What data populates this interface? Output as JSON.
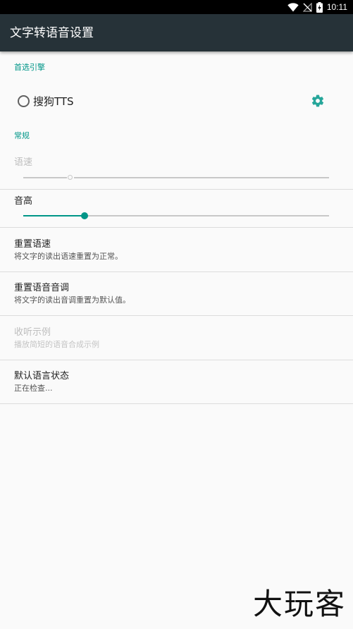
{
  "status_bar": {
    "time": "10:11",
    "icons": [
      "wifi-icon",
      "no-signal-icon",
      "battery-charging-icon"
    ]
  },
  "app_bar": {
    "title": "文字转语音设置"
  },
  "preferred_engine": {
    "category": "首选引擎",
    "engine_name": "搜狗TTS",
    "selected": false
  },
  "general": {
    "category": "常规",
    "speech_rate": {
      "title": "语速",
      "enabled": false,
      "value_fraction": 0.15
    },
    "pitch": {
      "title": "音高",
      "enabled": true,
      "value_fraction": 0.2
    },
    "reset_rate": {
      "title": "重置语速",
      "summary": "将文字的读出语速重置为正常。"
    },
    "reset_pitch": {
      "title": "重置语音音调",
      "summary": "将文字的读出音调重置为默认值。"
    },
    "listen_example": {
      "title": "收听示例",
      "summary": "播放简短的语音合成示例",
      "enabled": false
    },
    "default_language_status": {
      "title": "默认语言状态",
      "summary": "正在检查..."
    }
  },
  "watermark": "大玩客",
  "colors": {
    "accent": "#009688",
    "app_bar": "#263238",
    "background": "#fafafa"
  }
}
